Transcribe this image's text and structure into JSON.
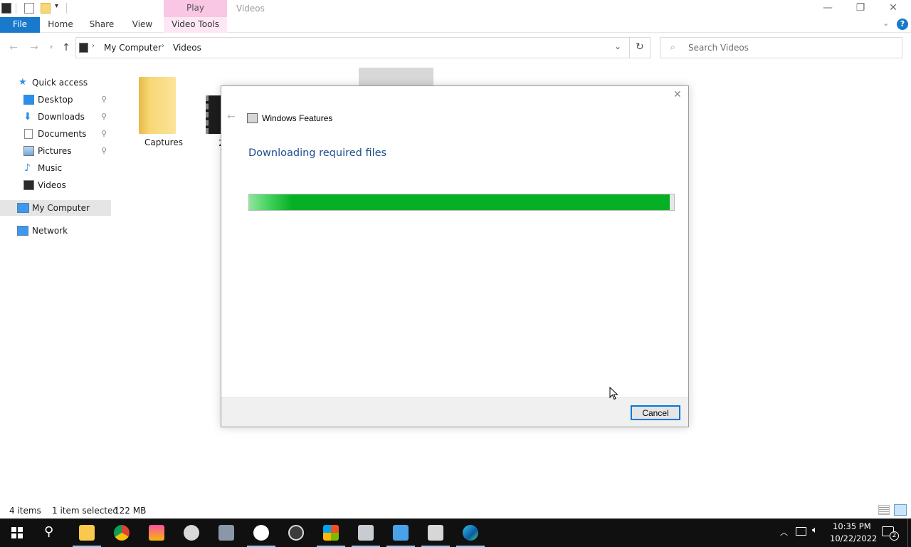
{
  "window": {
    "title": "Videos",
    "contextual_tab_group": "Play",
    "controls": {
      "minimize": "—",
      "maximize": "❐",
      "close": "✕"
    }
  },
  "ribbon": {
    "file": "File",
    "tabs": [
      "Home",
      "Share",
      "View",
      "Video Tools"
    ],
    "help": "?"
  },
  "address": {
    "path": [
      "My Computer",
      "Videos"
    ],
    "search_placeholder": "Search Videos"
  },
  "nav_pane": {
    "quick_access": "Quick access",
    "items": [
      {
        "label": "Desktop",
        "pinned": true
      },
      {
        "label": "Downloads",
        "pinned": true
      },
      {
        "label": "Documents",
        "pinned": true
      },
      {
        "label": "Pictures",
        "pinned": true
      },
      {
        "label": "Music",
        "pinned": false
      },
      {
        "label": "Videos",
        "pinned": false
      }
    ],
    "my_computer": "My Computer",
    "network": "Network"
  },
  "content": {
    "files": [
      {
        "name": "Captures",
        "type": "folder"
      },
      {
        "name": "2",
        "type": "video"
      }
    ]
  },
  "dialog": {
    "title": "Windows Features",
    "heading": "Downloading required files",
    "progress_fraction": 0.99,
    "cancel_label": "Cancel"
  },
  "status": {
    "items_count": "4 items",
    "selection": "1 item selected",
    "size": "122 MB"
  },
  "taskbar": {
    "apps": [
      "file-explorer",
      "chrome",
      "music-app",
      "paint-app",
      "camera-app",
      "help-app",
      "obs-app",
      "store-app",
      "remote-app",
      "network-app",
      "notepad-app",
      "edge"
    ],
    "clock_time": "10:35 PM",
    "clock_date": "10/22/2022",
    "notification_count": "2"
  },
  "colors": {
    "accent": "#0078d7",
    "file_tab": "#1979ca",
    "progress": "#06b025",
    "contextual_tab": "#f9c6e4",
    "dialog_heading": "#1e4e8c"
  }
}
